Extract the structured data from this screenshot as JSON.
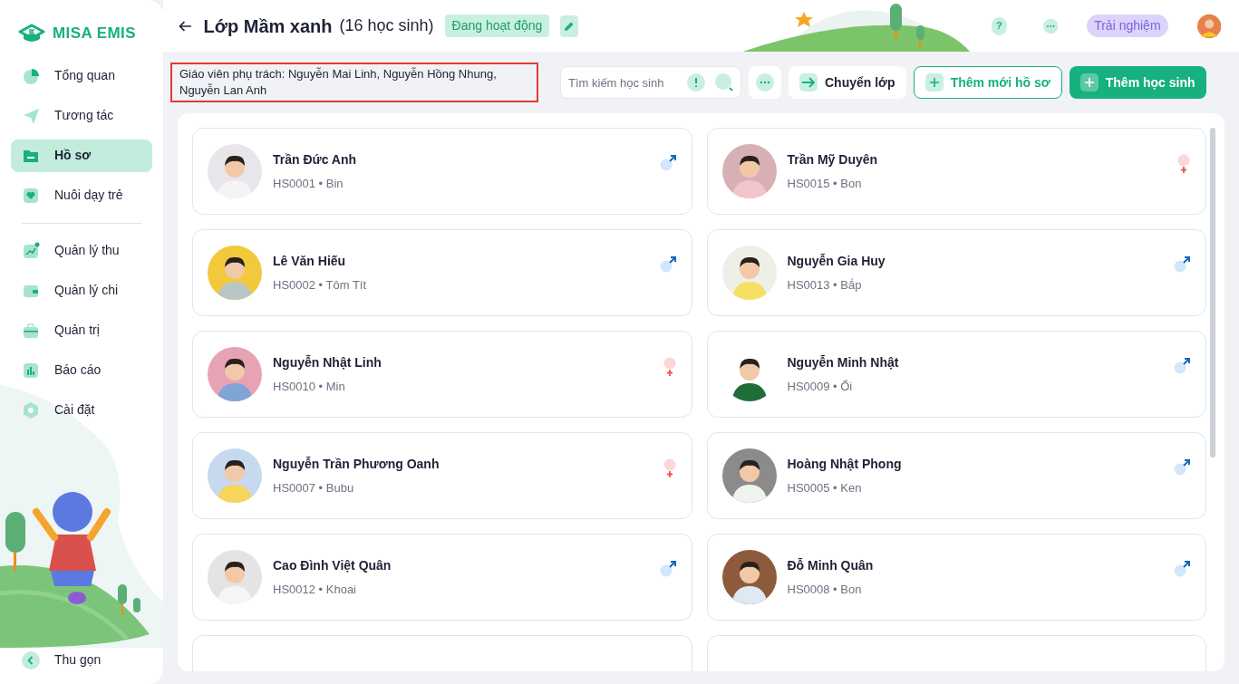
{
  "brand": "MISA EMIS",
  "sidebar": {
    "items": [
      {
        "label": "Tổng quan",
        "selected": false
      },
      {
        "label": "Tương tác",
        "selected": false
      },
      {
        "label": "Hồ sơ",
        "selected": true
      },
      {
        "label": "Nuôi dạy trẻ",
        "selected": false
      },
      {
        "label": "Quản lý thu",
        "selected": false
      },
      {
        "label": "Quản lý chi",
        "selected": false
      },
      {
        "label": "Quản trị",
        "selected": false
      },
      {
        "label": "Báo cáo",
        "selected": false
      },
      {
        "label": "Cài đặt",
        "selected": false
      }
    ],
    "collapse": "Thu gọn"
  },
  "header": {
    "title": "Lớp Mầm xanh",
    "count": "(16 học sinh)",
    "status": "Đang hoạt động",
    "help": "?",
    "trial": "Trải nghiệm"
  },
  "toolbar": {
    "teachers": "Giáo viên phụ trách: Nguyễn Mai Linh, Nguyễn Hồng Nhung, Nguyễn Lan Anh",
    "search": {
      "placeholder": "Tìm kiếm học sinh"
    },
    "buttons": [
      {
        "label": "Chuyển lớp",
        "kind": "plain"
      },
      {
        "label": "Thêm mới hồ sơ",
        "kind": "outline"
      },
      {
        "label": "Thêm học sinh",
        "kind": "primary"
      }
    ]
  },
  "students": [
    {
      "name": "Trần Đức Anh",
      "info": "HS0001 • Bin",
      "kind": "male"
    },
    {
      "name": "Trần Mỹ Duyên",
      "info": "HS0015 • Bon",
      "kind": "female"
    },
    {
      "name": "Lê Văn Hiếu",
      "info": "HS0002 • Tôm Tít",
      "kind": "male"
    },
    {
      "name": "Nguyễn Gia Huy",
      "info": "HS0013 • Bắp",
      "kind": "male"
    },
    {
      "name": "Nguyễn Nhật Linh",
      "info": "HS0010 • Min",
      "kind": "female"
    },
    {
      "name": "Nguyễn Minh Nhật",
      "info": "HS0009 • Ổi",
      "kind": "male"
    },
    {
      "name": "Nguyễn Trần Phương Oanh",
      "info": "HS0007 • Bubu",
      "kind": "female"
    },
    {
      "name": "Hoàng Nhật Phong",
      "info": "HS0005 • Ken",
      "kind": "male"
    },
    {
      "name": "Cao Đình Việt Quân",
      "info": "HS0012 • Khoai",
      "kind": "male"
    },
    {
      "name": "Đỗ Minh Quân",
      "info": "HS0008 • Bon",
      "kind": "male"
    }
  ]
}
